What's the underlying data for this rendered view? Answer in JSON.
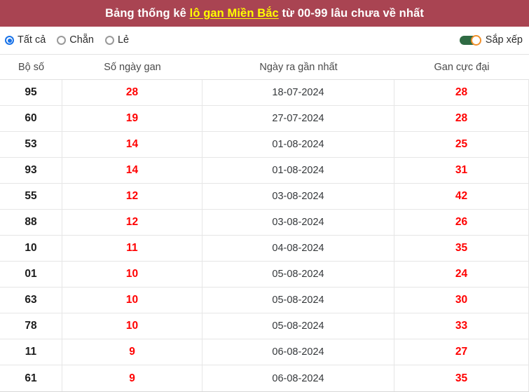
{
  "header": {
    "title_prefix": "Bảng thống kê ",
    "title_highlight": "lô gan Miền Bắc",
    "title_suffix": " từ 00-99 lâu chưa về nhất",
    "bg_color": "#a94452",
    "highlight_color": "#ffff00"
  },
  "controls": {
    "filters": [
      {
        "label": "Tất cả",
        "selected": true
      },
      {
        "label": "Chẵn",
        "selected": false
      },
      {
        "label": "Lẻ",
        "selected": false
      }
    ],
    "sort": {
      "label": "Sắp xếp",
      "enabled": true,
      "track_color": "#2f6b43",
      "knob_border_color": "#f2902a"
    },
    "radio_accent": "#1a73e8"
  },
  "table": {
    "columns": [
      "Bộ số",
      "Số ngày gan",
      "Ngày ra gần nhất",
      "Gan cực đại"
    ],
    "value_color": "#ff0000",
    "rows": [
      {
        "bo_so": "95",
        "so_ngay_gan": "28",
        "ngay_ra_gan_nhat": "18-07-2024",
        "gan_cuc_dai": "28"
      },
      {
        "bo_so": "60",
        "so_ngay_gan": "19",
        "ngay_ra_gan_nhat": "27-07-2024",
        "gan_cuc_dai": "28"
      },
      {
        "bo_so": "53",
        "so_ngay_gan": "14",
        "ngay_ra_gan_nhat": "01-08-2024",
        "gan_cuc_dai": "25"
      },
      {
        "bo_so": "93",
        "so_ngay_gan": "14",
        "ngay_ra_gan_nhat": "01-08-2024",
        "gan_cuc_dai": "31"
      },
      {
        "bo_so": "55",
        "so_ngay_gan": "12",
        "ngay_ra_gan_nhat": "03-08-2024",
        "gan_cuc_dai": "42"
      },
      {
        "bo_so": "88",
        "so_ngay_gan": "12",
        "ngay_ra_gan_nhat": "03-08-2024",
        "gan_cuc_dai": "26"
      },
      {
        "bo_so": "10",
        "so_ngay_gan": "11",
        "ngay_ra_gan_nhat": "04-08-2024",
        "gan_cuc_dai": "35"
      },
      {
        "bo_so": "01",
        "so_ngay_gan": "10",
        "ngay_ra_gan_nhat": "05-08-2024",
        "gan_cuc_dai": "24"
      },
      {
        "bo_so": "63",
        "so_ngay_gan": "10",
        "ngay_ra_gan_nhat": "05-08-2024",
        "gan_cuc_dai": "30"
      },
      {
        "bo_so": "78",
        "so_ngay_gan": "10",
        "ngay_ra_gan_nhat": "05-08-2024",
        "gan_cuc_dai": "33"
      },
      {
        "bo_so": "11",
        "so_ngay_gan": "9",
        "ngay_ra_gan_nhat": "06-08-2024",
        "gan_cuc_dai": "27"
      },
      {
        "bo_so": "61",
        "so_ngay_gan": "9",
        "ngay_ra_gan_nhat": "06-08-2024",
        "gan_cuc_dai": "35"
      }
    ]
  }
}
